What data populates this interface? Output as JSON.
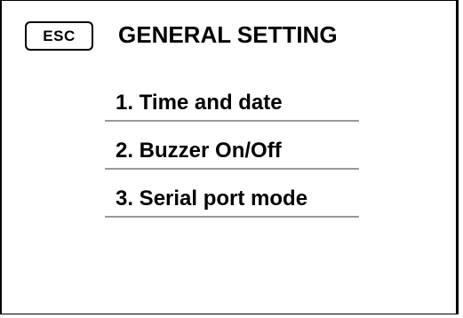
{
  "header": {
    "esc_label": "ESC",
    "title": "GENERAL SETTING"
  },
  "menu": {
    "items": [
      {
        "label": "1. Time and date"
      },
      {
        "label": "2. Buzzer On/Off"
      },
      {
        "label": "3. Serial port mode"
      }
    ]
  }
}
